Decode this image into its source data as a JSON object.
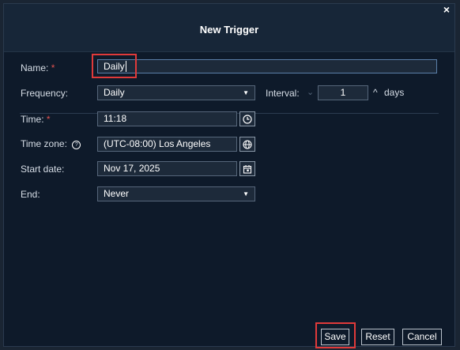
{
  "dialog": {
    "title": "New Trigger",
    "close_glyph": "×"
  },
  "form": {
    "name": {
      "label": "Name:",
      "required_mark": "*",
      "value": "Daily"
    },
    "frequency": {
      "label": "Frequency:",
      "value": "Daily"
    },
    "interval": {
      "label": "Interval:",
      "value": "1",
      "unit": "days"
    },
    "time": {
      "label": "Time:",
      "required_mark": "*",
      "value": "11:18"
    },
    "timezone": {
      "label": "Time zone:",
      "value": "(UTC-08:00) Los Angeles"
    },
    "start_date": {
      "label": "Start date:",
      "value": "Nov 17, 2025"
    },
    "end": {
      "label": "End:",
      "value": "Never"
    }
  },
  "buttons": {
    "save": "Save",
    "reset": "Reset",
    "cancel": "Cancel"
  },
  "colors": {
    "background": "#0e1a2a",
    "highlight": "#e03a3a",
    "required": "#e0524f"
  }
}
